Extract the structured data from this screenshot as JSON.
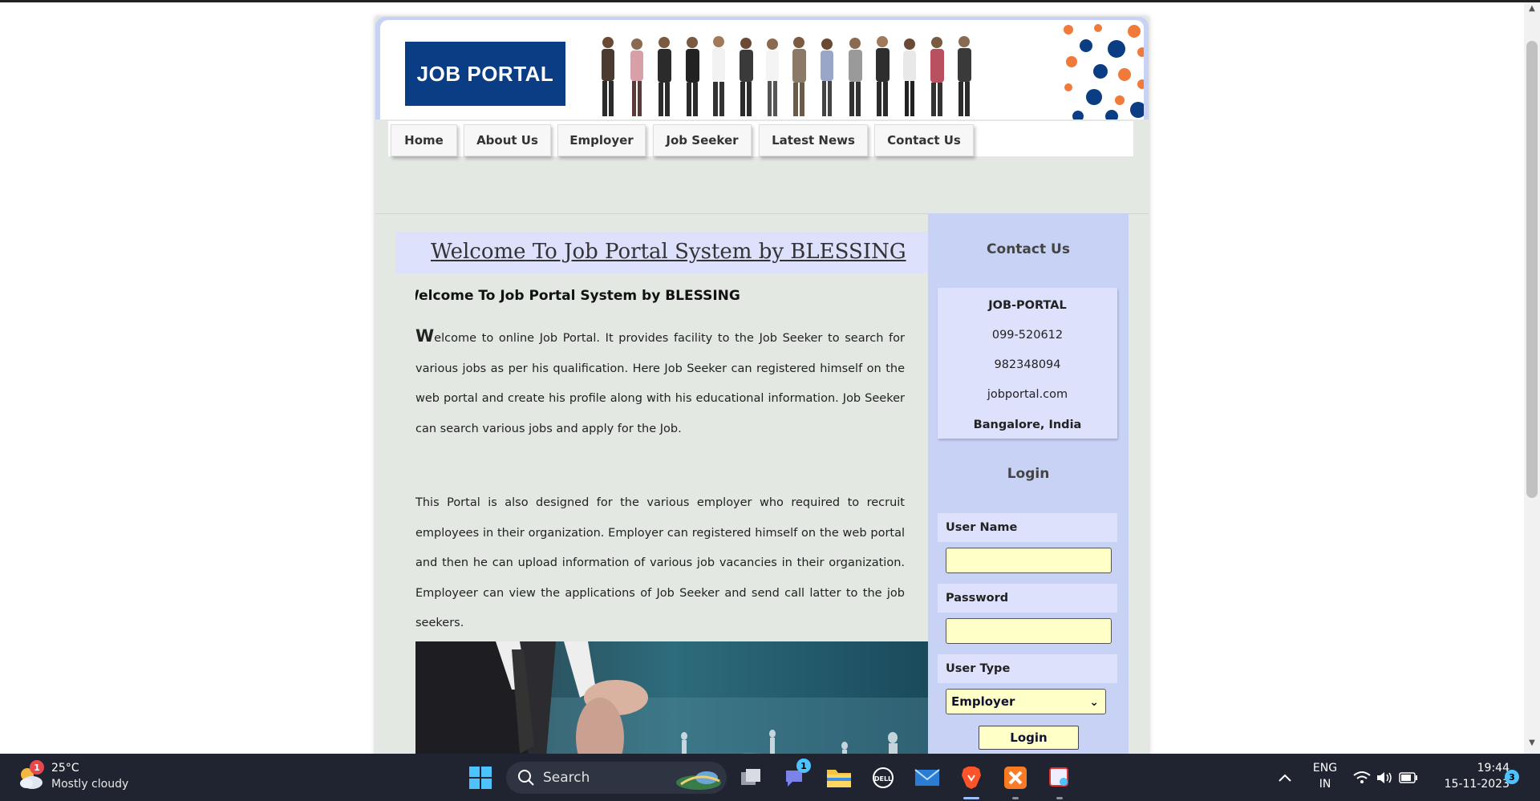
{
  "site": {
    "logo_text": "JOB PORTAL",
    "nav": [
      "Home",
      "About Us",
      "Employer",
      "Job Seeker",
      "Latest News",
      "Contact Us"
    ],
    "welcome_title": "Welcome To Job Portal System by BLESSING",
    "marquee_text": "Welcome To Job Portal System by BLESSING",
    "para1_drop": "W",
    "para1_rest": "elcome to online Job Portal. It provides facility to the Job Seeker to search for various jobs as per his qualification. Here Job Seeker can registered himself on the web portal and create his profile along with his educational information. Job Seeker can search various jobs and apply for the Job.",
    "para2": "This Portal is also designed for the various employer who required to recruit employees in their organization. Employer can registered himself on the web portal and then he can upload information of various job vacancies in their organization. Employeer can view the applications of Job Seeker and send call latter to the job seekers."
  },
  "sidebar": {
    "contact_heading": "Contact Us",
    "contact": {
      "name": "JOB-PORTAL",
      "phone1": "099-520612",
      "phone2": "982348094",
      "website": "jobportal.com",
      "location": "Bangalore, India"
    },
    "login_heading": "Login",
    "username_label": "User Name",
    "password_label": "Password",
    "usertype_label": "User Type",
    "usertype_selected": "Employer",
    "login_button": "Login"
  },
  "taskbar": {
    "weather_temp": "25°C",
    "weather_desc": "Mostly cloudy",
    "weather_badge": "1",
    "search_label": "Search",
    "teams_badge": "1",
    "lang_line1": "ENG",
    "lang_line2": "IN",
    "time": "19:44",
    "date": "15-11-2023",
    "notification_count": "3"
  },
  "colors": {
    "logo_bg": "#0a3d84",
    "sidebar_bg": "#c8d2f5",
    "panel_bg": "#e3e8e3",
    "input_bg": "#ffffc8",
    "taskbar_bg": "#1f2430"
  }
}
